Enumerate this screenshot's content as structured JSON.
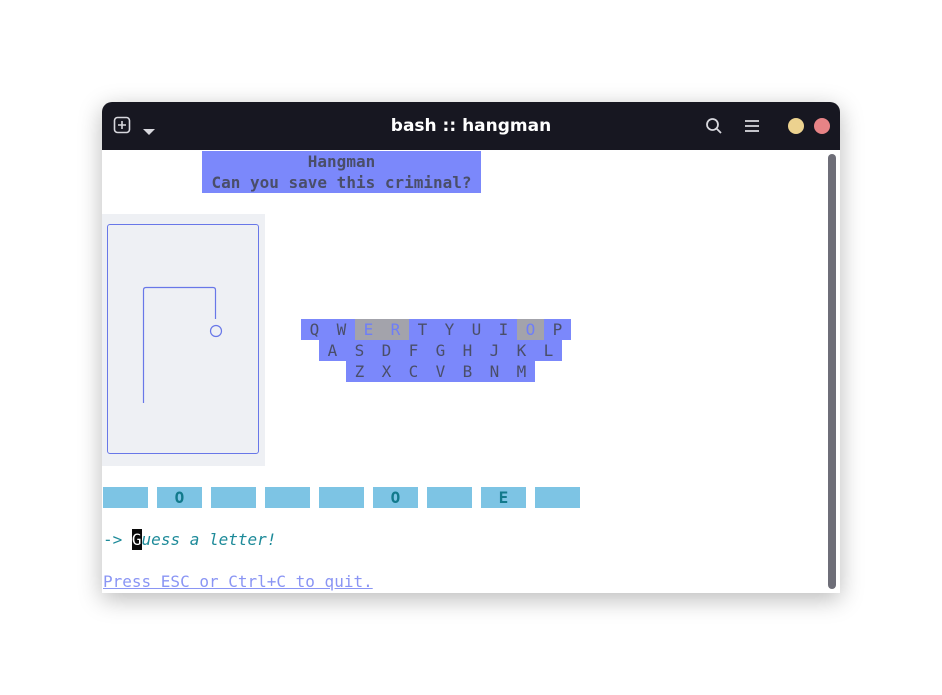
{
  "window": {
    "title": "bash :: hangman",
    "dots": {
      "minimize_color": "#ecd28f",
      "close_color": "#e78386"
    }
  },
  "colors": {
    "accent": "#7b88fb",
    "used_key": "#a3a3ab",
    "slot": "#7dc4e4",
    "prompt": "#1d8a99"
  },
  "icons": {
    "new_tab": "new-tab-icon",
    "dropdown": "chevron-down-icon",
    "search": "search-icon",
    "menu": "hamburger-menu-icon"
  },
  "game": {
    "header": {
      "title": "Hangman",
      "subtitle": "Can you save this criminal?"
    },
    "wrong_guesses": 2,
    "keyboard": {
      "rows": [
        [
          "Q",
          "W",
          "E",
          "R",
          "T",
          "Y",
          "U",
          "I",
          "O",
          "P"
        ],
        [
          "A",
          "S",
          "D",
          "F",
          "G",
          "H",
          "J",
          "K",
          "L"
        ],
        [
          "Z",
          "X",
          "C",
          "V",
          "B",
          "N",
          "M"
        ]
      ],
      "used": [
        "E",
        "R",
        "O"
      ]
    },
    "word_slots": [
      "",
      "O",
      "",
      "",
      "",
      "O",
      "",
      "E",
      ""
    ],
    "prompt": {
      "arrow": "->",
      "cursor_char": "G",
      "message_rest": "uess a letter!"
    },
    "quit_hint": "Press ESC or Ctrl+C to quit."
  }
}
